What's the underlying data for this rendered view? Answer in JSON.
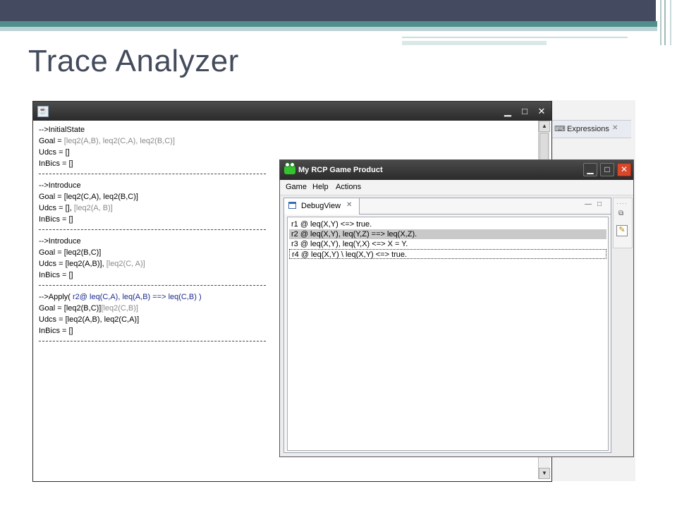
{
  "slide": {
    "title": "Trace Analyzer"
  },
  "background_view": {
    "tab_label": "Expressions"
  },
  "trace_window": {
    "lines": [
      {
        "text": "-->InitialState"
      },
      {
        "label": "Goal  = ",
        "value": "[leq2(A,B), leq2(C,A), leq2(B,C)]"
      },
      {
        "label": "Udcs   = ",
        "value": "[]"
      },
      {
        "label": "InBics = ",
        "value": "[]"
      },
      {
        "text": "-->Introduce"
      },
      {
        "label": "Goal = ",
        "value": "[leq2(C,A), leq2(B,C)]"
      },
      {
        "label": "Udcs   = ",
        "value": "[], ",
        "extra": "[leq2(A, B)]"
      },
      {
        "label": "InBics = ",
        "value": "[]"
      },
      {
        "text": "-->Introduce"
      },
      {
        "label": "Goal = ",
        "value": "[leq2(B,C)]"
      },
      {
        "label": "Udcs   = ",
        "value": "[leq2(A,B)], ",
        "extra": "[leq2(C, A)]"
      },
      {
        "label": "InBics = ",
        "value": "[]"
      },
      {
        "text": "-->Apply( ",
        "rule": "r2@ leq(C,A), leq(A,B) ==> leq(C,B) )"
      },
      {
        "label": "Goal  = ",
        "value": "[leq2(B,C)]",
        "extra": "[leq2(C,B)]"
      },
      {
        "label": "Udcs   = ",
        "value": "[leq2(A,B), leq2(C,A)]"
      },
      {
        "label": "InBics = ",
        "value": "[]"
      }
    ]
  },
  "rcp_window": {
    "title": "My RCP Game Product",
    "menu": {
      "game": "Game",
      "help": "Help",
      "actions": "Actions"
    },
    "view_tab": "DebugView",
    "rules": [
      "r1 @ leq(X,Y) <=> true.",
      "r2 @ leq(X,Y), leq(Y,Z) ==> leq(X,Z).",
      "r3 @ leq(X,Y), leq(Y,X) <=> X = Y.",
      "r4 @ leq(X,Y) \\ leq(X,Y) <=> true."
    ],
    "selected_rule_index": 1
  },
  "colors": {
    "slide_topbar": "#444a60",
    "slide_accent": "#4f8f8c",
    "title_text": "#434b5c",
    "rule_selection": "#c9c9c9",
    "close_button": "#d9472b"
  }
}
